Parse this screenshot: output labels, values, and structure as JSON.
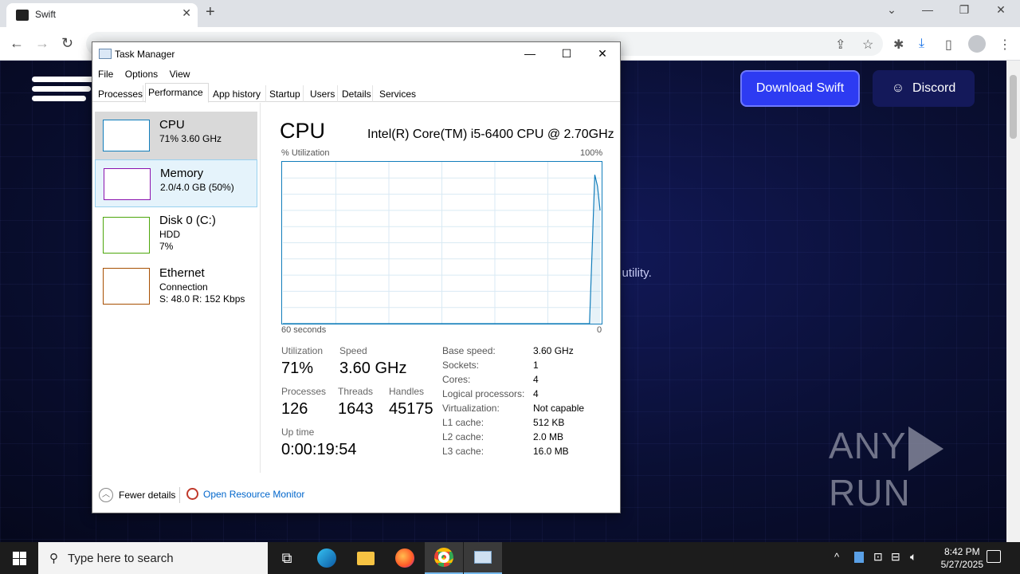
{
  "browser": {
    "tab_title": "Swift",
    "tab_close": "✕",
    "new_tab": "+",
    "window_controls": [
      "⌄",
      "—",
      "❐",
      "✕"
    ],
    "nav": {
      "back": "←",
      "forward": "→",
      "reload": "↻"
    }
  },
  "site": {
    "download_button": "Download Swift",
    "discord_button": "Discord",
    "partial_text": "g utility.",
    "watermark": "ANY RUN"
  },
  "task_manager": {
    "title": "Task Manager",
    "controls": {
      "minimize": "—",
      "maximize": "☐",
      "close": "✕"
    },
    "menu": [
      "File",
      "Options",
      "View"
    ],
    "tabs": [
      "Processes",
      "Performance",
      "App history",
      "Startup",
      "Users",
      "Details",
      "Services"
    ],
    "active_tab": "Performance",
    "resources": [
      {
        "name": "CPU",
        "line1": "71%  3.60 GHz",
        "line2": "",
        "color": "#117dbb"
      },
      {
        "name": "Memory",
        "line1": "2.0/4.0 GB (50%)",
        "line2": "",
        "color": "#8b12ae"
      },
      {
        "name": "Disk 0 (C:)",
        "line1": "HDD",
        "line2": "7%",
        "color": "#4da60c"
      },
      {
        "name": "Ethernet",
        "line1": "Connection",
        "line2": "S: 48.0  R: 152 Kbps",
        "color": "#a74f01"
      }
    ],
    "cpu": {
      "title": "CPU",
      "model": "Intel(R) Core(TM) i5-6400 CPU @ 2.70GHz",
      "graph_label": "% Utilization",
      "graph_max": "100%",
      "graph_left": "60 seconds",
      "graph_right": "0",
      "stats": {
        "utilization_label": "Utilization",
        "utilization": "71%",
        "speed_label": "Speed",
        "speed": "3.60 GHz",
        "processes_label": "Processes",
        "processes": "126",
        "threads_label": "Threads",
        "threads": "1643",
        "handles_label": "Handles",
        "handles": "45175",
        "uptime_label": "Up time",
        "uptime": "0:00:19:54"
      },
      "details": [
        {
          "k": "Base speed:",
          "v": "3.60 GHz"
        },
        {
          "k": "Sockets:",
          "v": "1"
        },
        {
          "k": "Cores:",
          "v": "4"
        },
        {
          "k": "Logical processors:",
          "v": "4"
        },
        {
          "k": "Virtualization:",
          "v": "Not capable"
        },
        {
          "k": "L1 cache:",
          "v": "512 KB"
        },
        {
          "k": "L2 cache:",
          "v": "2.0 MB"
        },
        {
          "k": "L3 cache:",
          "v": "16.0 MB"
        }
      ]
    },
    "footer": {
      "fewer_details": "Fewer details",
      "resource_monitor": "Open Resource Monitor"
    }
  },
  "chart_data": {
    "type": "line",
    "x": [
      0,
      58,
      59,
      59.5,
      60
    ],
    "values": [
      0,
      0,
      92,
      85,
      70
    ],
    "xlabel": "60 seconds",
    "ylabel": "% Utilization",
    "ylim": [
      0,
      100
    ],
    "grid": true,
    "series_color": "#117dbb"
  },
  "taskbar": {
    "search_placeholder": "Type here to search",
    "time": "8:42 PM",
    "date": "5/27/2025"
  }
}
